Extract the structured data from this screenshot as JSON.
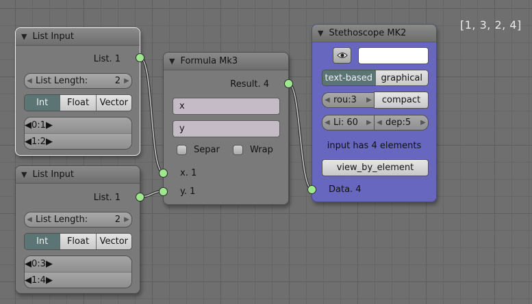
{
  "output_text": "[1, 3, 2, 4]",
  "node1": {
    "title": "List Input",
    "output_label": "List. 1",
    "length_label": "List Length:",
    "length_value": "2",
    "types": [
      "Int",
      "Float",
      "Vector"
    ],
    "active_type": "Int",
    "items": [
      {
        "label": "0:",
        "value": "1"
      },
      {
        "label": "1:",
        "value": "2"
      }
    ]
  },
  "node2": {
    "title": "List Input",
    "output_label": "List. 1",
    "length_label": "List Length:",
    "length_value": "2",
    "types": [
      "Int",
      "Float",
      "Vector"
    ],
    "active_type": "Int",
    "items": [
      {
        "label": "0:",
        "value": "3"
      },
      {
        "label": "1:",
        "value": "4"
      }
    ]
  },
  "formula": {
    "title": "Formula Mk3",
    "output_label": "Result. 4",
    "formula_1": "x",
    "formula_2": "y",
    "separate_label": "Separ",
    "wrap_label": "Wrap",
    "input_x": "x. 1",
    "input_y": "y. 1"
  },
  "stethoscope": {
    "title": "Stethoscope MK2",
    "mode_options": [
      "text-based",
      "graphical"
    ],
    "active_mode": "text-based",
    "rounding_label": "rou:3",
    "compact_label": "compact",
    "line_label": "Li: 60",
    "depth_label": "dep:5",
    "info_text": "input has 4 elements",
    "view_button": "view_by_element",
    "input_label": "Data. 4",
    "node_color": "#6767c0"
  },
  "colors": {
    "socket": "#9fe890",
    "active_option": "#5b7474"
  }
}
